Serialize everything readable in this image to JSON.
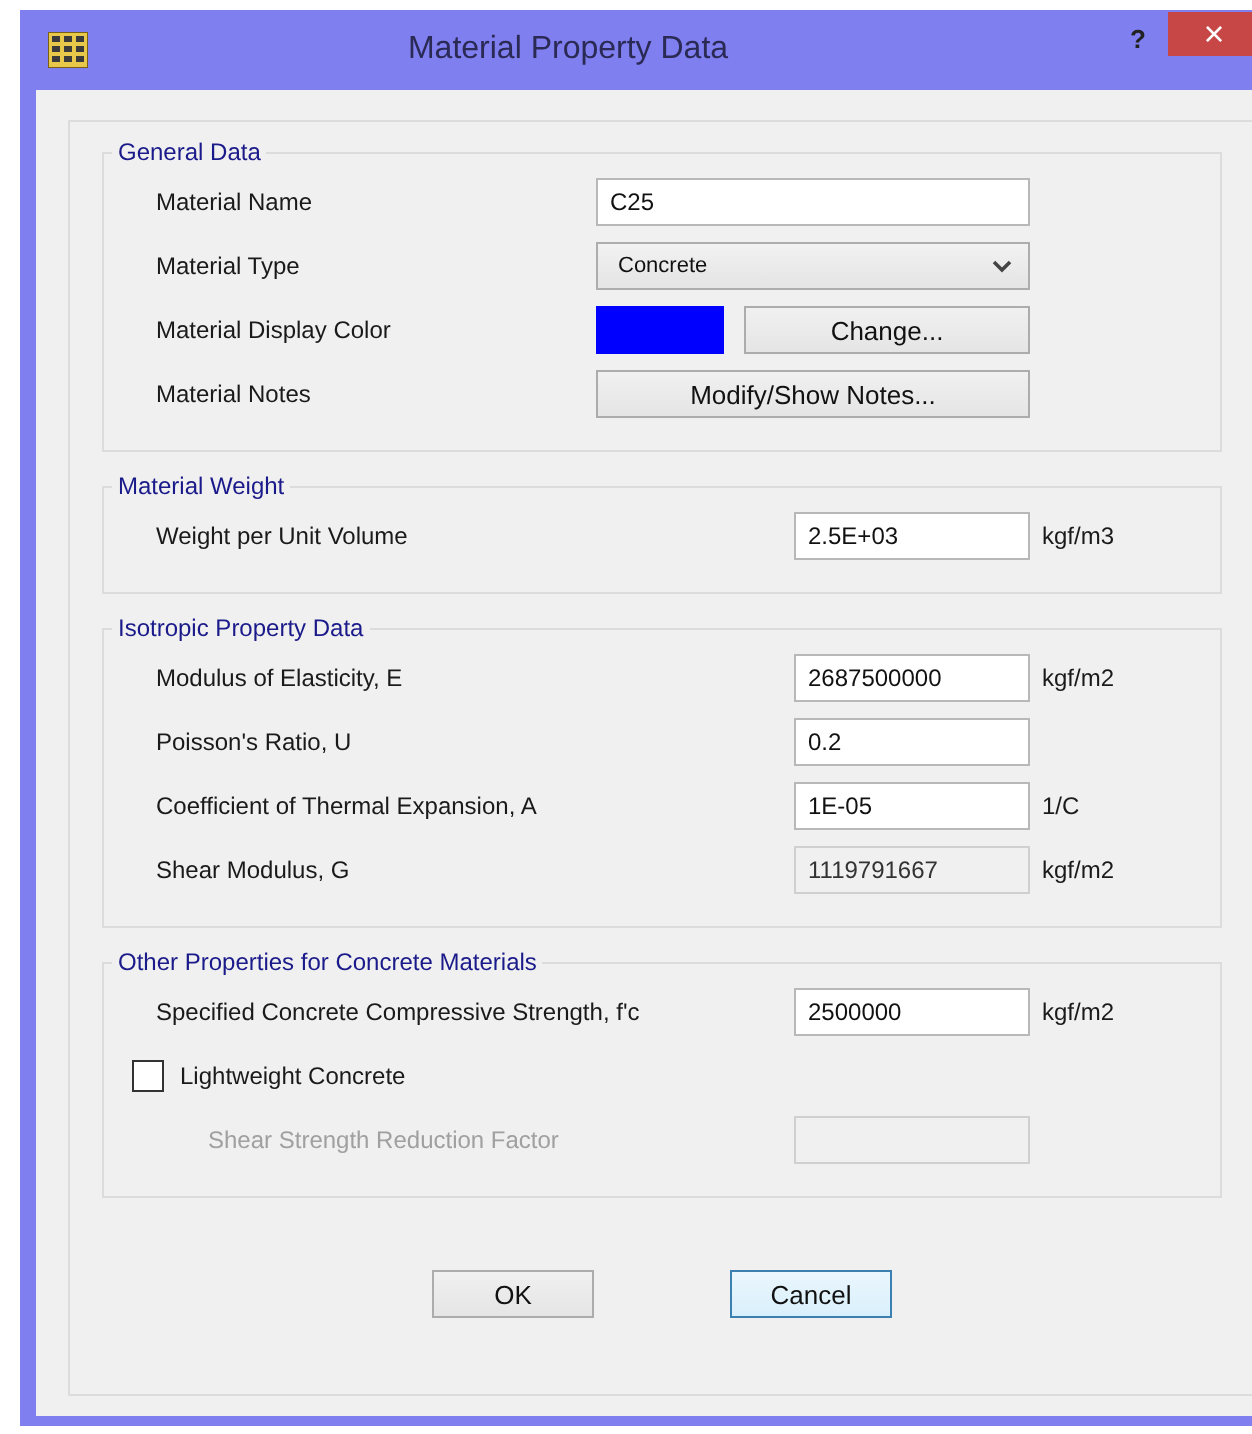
{
  "window": {
    "title": "Material Property Data",
    "help": "?",
    "close": "×"
  },
  "groups": [
    {
      "title": "General Data",
      "rows": [
        {
          "kind": "input",
          "label": "Material Name",
          "value": "C25",
          "disabled": false
        },
        {
          "kind": "dropdown",
          "label": "Material Type",
          "value": "Concrete"
        },
        {
          "kind": "color",
          "label": "Material Display Color",
          "color": "#0000ff",
          "button": "Change..."
        },
        {
          "kind": "button",
          "label": "Material Notes",
          "button": "Modify/Show Notes..."
        }
      ]
    },
    {
      "title": "Material Weight",
      "rows": [
        {
          "kind": "input",
          "label": "Weight per Unit Volume",
          "value": "2.5E+03",
          "unit": "kgf/m3",
          "disabled": false
        }
      ]
    },
    {
      "title": "Isotropic Property Data",
      "rows": [
        {
          "kind": "input",
          "label": "Modulus of Elasticity,  E",
          "value": "2687500000",
          "unit": "kgf/m2",
          "disabled": false
        },
        {
          "kind": "input",
          "label": "Poisson's Ratio,  U",
          "value": "0.2",
          "disabled": false
        },
        {
          "kind": "input",
          "label": "Coefficient of Thermal Expansion,  A",
          "value": "1E-05",
          "unit": "1/C",
          "disabled": false
        },
        {
          "kind": "input",
          "label": "Shear Modulus,  G",
          "value": "1119791667",
          "unit": "kgf/m2",
          "disabled": true
        }
      ]
    },
    {
      "title": "Other Properties for Concrete Materials",
      "rows": [
        {
          "kind": "input",
          "label": "Specified Concrete Compressive Strength, f'c",
          "value": "2500000",
          "unit": "kgf/m2",
          "disabled": false
        },
        {
          "kind": "checkbox",
          "label": "Lightweight Concrete",
          "checked": false
        },
        {
          "kind": "sub-input",
          "label": "Shear Strength Reduction Factor",
          "disabled": true
        }
      ]
    }
  ],
  "buttons": [
    {
      "label": "OK",
      "focused": false
    },
    {
      "label": "Cancel",
      "focused": true
    }
  ]
}
